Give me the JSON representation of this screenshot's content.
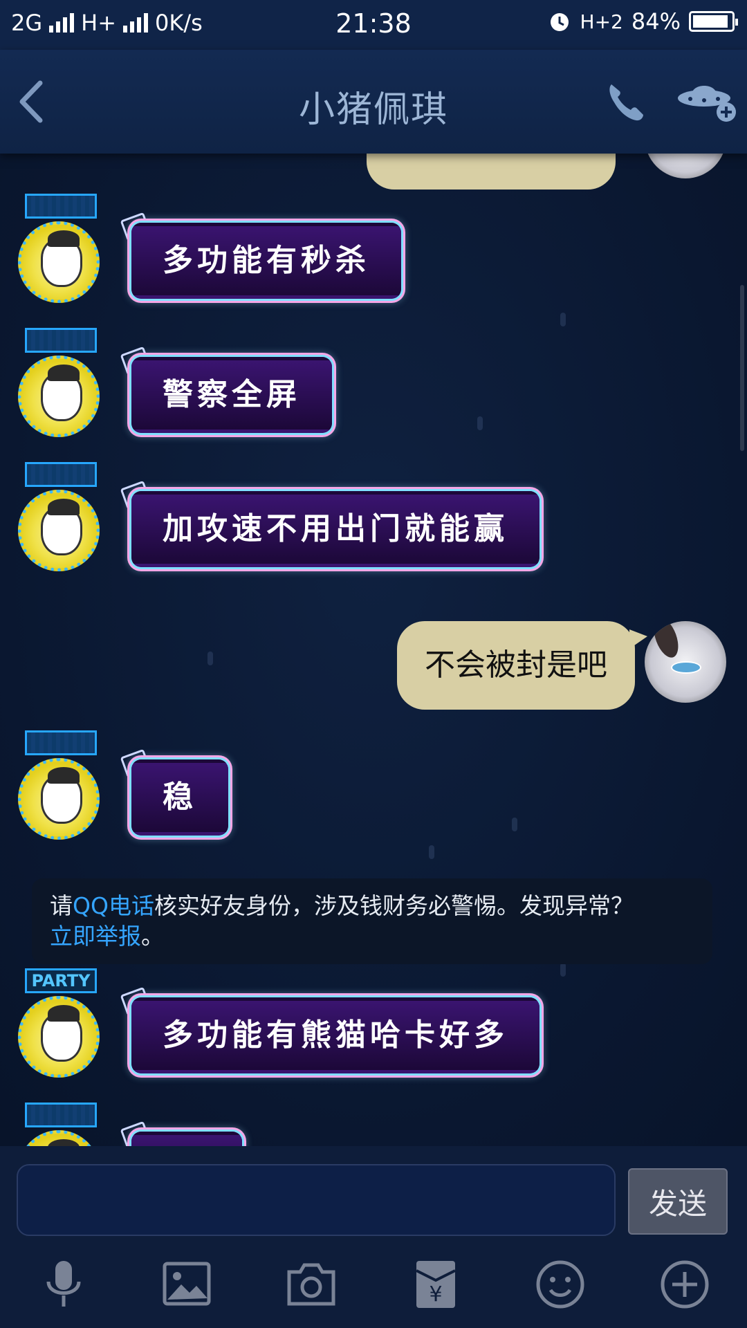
{
  "status_bar": {
    "network1": "2G",
    "network2": "H+",
    "speed": "0K/s",
    "time": "21:38",
    "network3": "H+2",
    "battery": "84%"
  },
  "header": {
    "title": "小猪佩琪"
  },
  "messages": [
    {
      "side": "left",
      "text": "多功能有秒杀",
      "badge": ""
    },
    {
      "side": "left",
      "text": "警察全屏",
      "badge": ""
    },
    {
      "side": "left",
      "text": "加攻速不用出门就能赢",
      "badge": ""
    },
    {
      "side": "right",
      "text": "不会被封是吧"
    },
    {
      "side": "left",
      "text": "稳",
      "badge": ""
    },
    {
      "side": "left",
      "text": "多功能有熊猫哈卡好多",
      "badge": "PARTY"
    }
  ],
  "notice": {
    "part1": "请",
    "link1": "QQ电话",
    "part2": "核实好友身份，涉及钱财务必警惕。发现异常？",
    "link2": "立即举报",
    "part3": "。"
  },
  "input": {
    "value": "",
    "send_label": "发送"
  },
  "toolbar": {
    "icons": [
      "microphone-icon",
      "image-icon",
      "camera-icon",
      "red-packet-icon",
      "emoji-icon",
      "plus-icon"
    ]
  },
  "colors": {
    "background": "#0b1a33",
    "my_bubble": "#d8cfa4",
    "link": "#35a5ff"
  }
}
